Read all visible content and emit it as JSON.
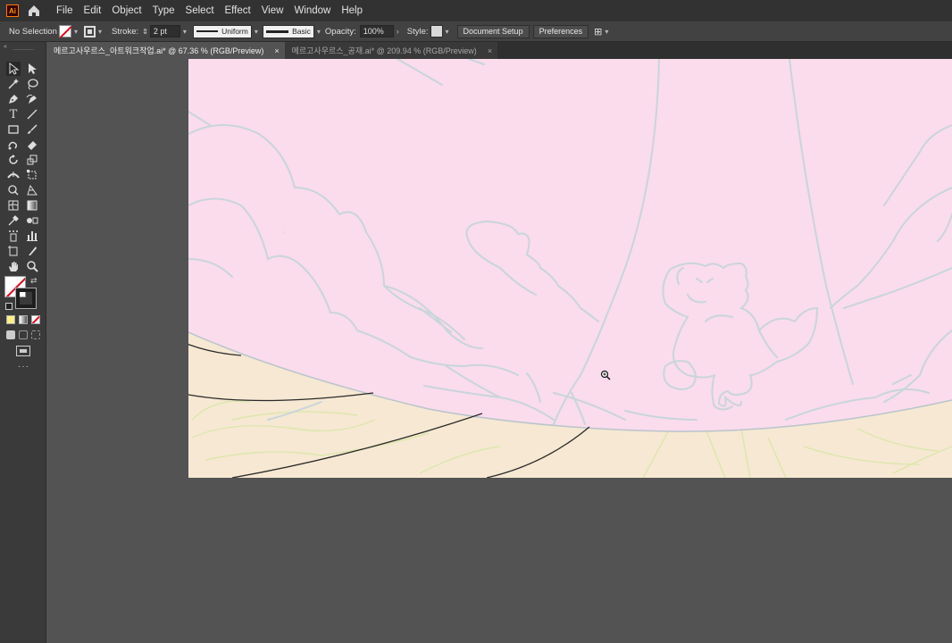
{
  "app": {
    "logo": "Ai"
  },
  "menu": [
    "File",
    "Edit",
    "Object",
    "Type",
    "Select",
    "Effect",
    "View",
    "Window",
    "Help"
  ],
  "controlbar": {
    "selection_status": "No Selection",
    "stroke_label": "Stroke:",
    "stroke_weight": "2 pt",
    "stroke_profile": "Uniform",
    "brush": "Basic",
    "opacity_label": "Opacity:",
    "opacity_value": "100%",
    "style_label": "Style:",
    "document_setup": "Document Setup",
    "preferences": "Preferences"
  },
  "tabs": [
    {
      "label": "메르고사우르스_아트워크작업.ai* @ 67.36 % (RGB/Preview)",
      "close": "×",
      "active": true
    },
    {
      "label": "메르고사우르스_공재.ai* @ 209.94 % (RGB/Preview)",
      "close": "×",
      "active": false
    }
  ],
  "colors": {
    "canvas_pink": "#fadcec",
    "ground_beige": "#f6e8d2",
    "sketch_blue": "#c9d5db",
    "ground_lines": "#d9e6a8",
    "accent": "#ff9a00"
  },
  "tools": [
    "selection-tool",
    "direct-selection-tool",
    "magic-wand-tool",
    "lasso-tool",
    "pen-tool",
    "curvature-tool",
    "type-tool",
    "line-tool",
    "rectangle-tool",
    "paintbrush-tool",
    "shaper-tool",
    "eraser-tool",
    "rotate-tool",
    "scale-tool",
    "width-tool",
    "free-transform-tool",
    "shape-builder-tool",
    "perspective-grid-tool",
    "mesh-tool",
    "gradient-tool",
    "eyedropper-tool",
    "blend-tool",
    "symbol-sprayer-tool",
    "column-graph-tool",
    "artboard-tool",
    "slice-tool",
    "hand-tool",
    "zoom-tool"
  ]
}
